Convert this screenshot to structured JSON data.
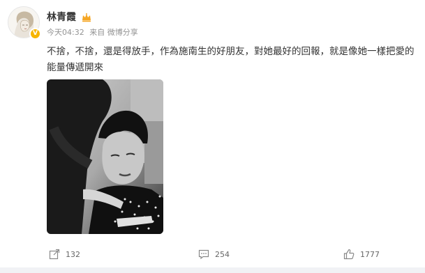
{
  "post": {
    "author": "林青霞",
    "time": "今天04:32",
    "source": "来自 微博分享",
    "text": "不捨，不捨，還是得放手，作為施南生的好朋友，對她最好的回報，就是像她一樣把愛的能量傳遞開來"
  },
  "actions": {
    "share_count": "132",
    "comment_count": "254",
    "like_count": "1777"
  },
  "icons": {
    "verified": "verified-badge-icon",
    "crown": "crown-icon",
    "share": "share-icon",
    "comment": "comment-icon",
    "like": "thumbs-up-icon"
  },
  "colors": {
    "verified_badge": "#f7b500",
    "crown": "#f5a623",
    "text": "#333333",
    "meta": "#939393"
  }
}
